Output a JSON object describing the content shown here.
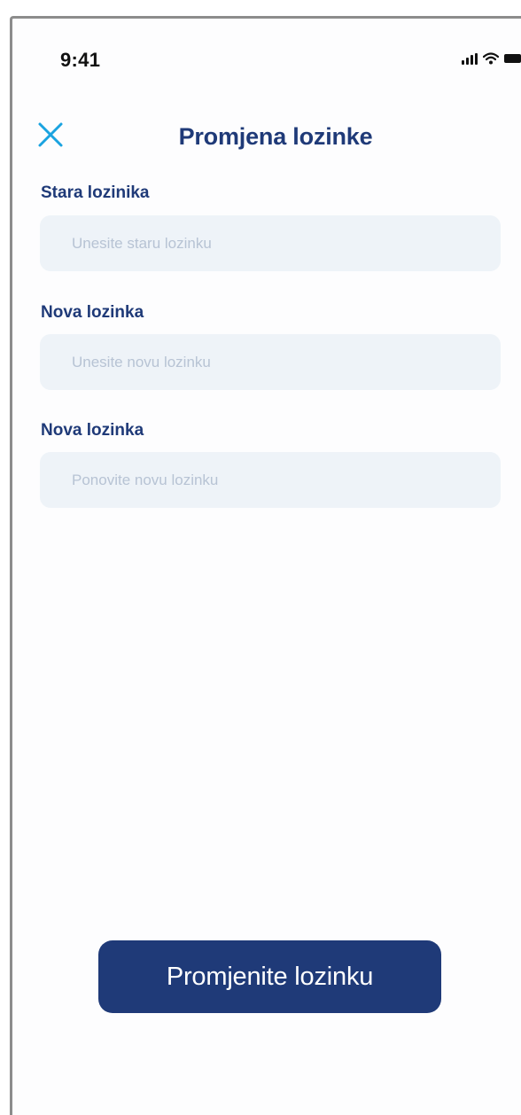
{
  "status_bar": {
    "time": "9:41",
    "icons": [
      "signal-icon",
      "wifi-icon",
      "battery-icon"
    ]
  },
  "header": {
    "close_icon": "close-icon",
    "title": "Promjena lozinke"
  },
  "form": {
    "fields": [
      {
        "label": "Stara lozinika",
        "value": "",
        "placeholder": "Unesite staru lozinku"
      },
      {
        "label": "Nova lozinka",
        "value": "",
        "placeholder": "Unesite novu lozinku"
      },
      {
        "label": "Nova lozinka",
        "value": "",
        "placeholder": "Ponovite novu lozinku"
      }
    ]
  },
  "submit": {
    "label": "Promjenite lozinku"
  },
  "colors": {
    "primary": "#1f3a78",
    "accent_close": "#1aa3e0",
    "input_background": "#eef3f8",
    "placeholder": "#b7c3d4"
  }
}
